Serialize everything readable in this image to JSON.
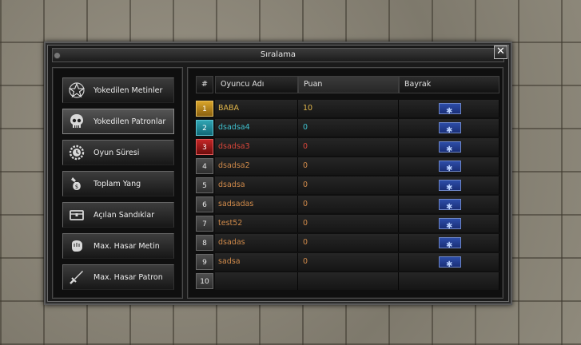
{
  "window": {
    "title": "Sıralama",
    "close_glyph": "✕"
  },
  "categories": [
    {
      "label": "Yokedilen Metinler",
      "icon": "pentagram-icon"
    },
    {
      "label": "Yokedilen Patronlar",
      "icon": "skull-icon"
    },
    {
      "label": "Oyun Süresi",
      "icon": "clock-gear-icon"
    },
    {
      "label": "Toplam Yang",
      "icon": "money-bag-icon"
    },
    {
      "label": "Açılan Sandıklar",
      "icon": "chest-icon"
    },
    {
      "label": "Max. Hasar Metin",
      "icon": "fist-icon"
    },
    {
      "label": "Max. Hasar Patron",
      "icon": "sword-icon"
    }
  ],
  "table": {
    "headers": {
      "rank": "#",
      "player": "Oyuncu Adı",
      "score": "Puan",
      "flag": "Bayrak"
    },
    "rows": [
      {
        "rank": "1",
        "name": "BABA",
        "score": "10",
        "color": "#e0b54a",
        "badge": "gold"
      },
      {
        "rank": "2",
        "name": "dsadsa4",
        "score": "0",
        "color": "#3fc1cf",
        "badge": "teal"
      },
      {
        "rank": "3",
        "name": "dsadsa3",
        "score": "0",
        "color": "#d9463a",
        "badge": "red"
      },
      {
        "rank": "4",
        "name": "dsadsa2",
        "score": "0",
        "color": "#d08a4a",
        "badge": "gray"
      },
      {
        "rank": "5",
        "name": "dsadsa",
        "score": "0",
        "color": "#d08a4a",
        "badge": "gray"
      },
      {
        "rank": "6",
        "name": "sadsadas",
        "score": "0",
        "color": "#d08a4a",
        "badge": "gray"
      },
      {
        "rank": "7",
        "name": "test52",
        "score": "0",
        "color": "#d08a4a",
        "badge": "gray"
      },
      {
        "rank": "8",
        "name": "dsadas",
        "score": "0",
        "color": "#d08a4a",
        "badge": "gray"
      },
      {
        "rank": "9",
        "name": "sadsa",
        "score": "0",
        "color": "#d08a4a",
        "badge": "gray"
      },
      {
        "rank": "10",
        "name": "",
        "score": "",
        "color": "#d08a4a",
        "badge": "gray"
      }
    ]
  }
}
